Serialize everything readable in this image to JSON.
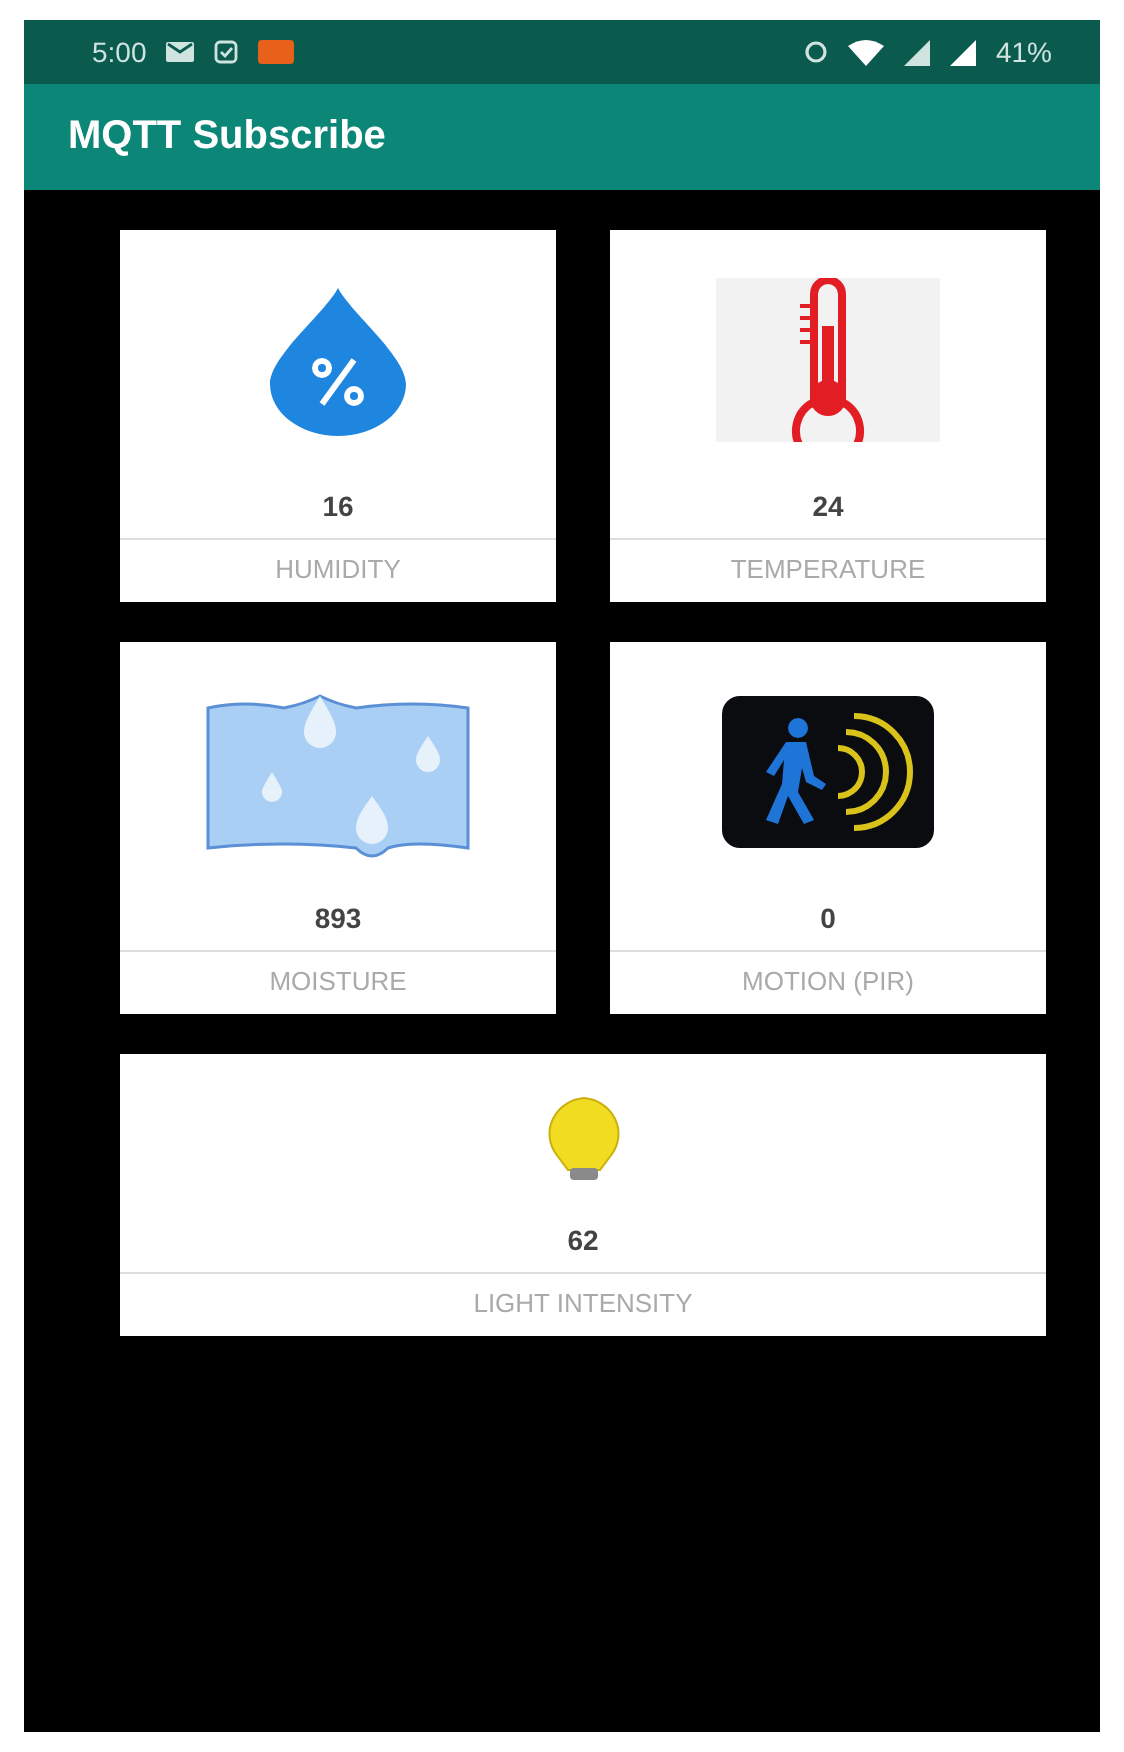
{
  "status_bar": {
    "time": "5:00",
    "battery": "41%"
  },
  "app_bar": {
    "title": "MQTT Subscribe"
  },
  "sensors": [
    {
      "kind": "humidity",
      "value": "16",
      "label": "HUMIDITY"
    },
    {
      "kind": "temperature",
      "value": "24",
      "label": "TEMPERATURE"
    },
    {
      "kind": "moisture",
      "value": "893",
      "label": "MOISTURE"
    },
    {
      "kind": "motion",
      "value": "0",
      "label": "MOTION (PIR)"
    },
    {
      "kind": "light",
      "value": "62",
      "label": "LIGHT INTENSITY"
    }
  ]
}
